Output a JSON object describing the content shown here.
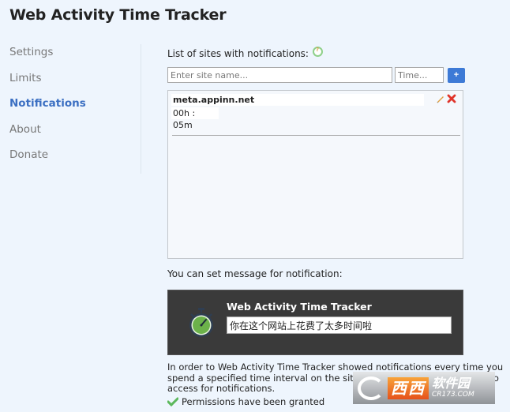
{
  "app": {
    "title": "Web Activity Time Tracker"
  },
  "sidebar": {
    "items": [
      {
        "label": "Settings",
        "active": false
      },
      {
        "label": "Limits",
        "active": false
      },
      {
        "label": "Notifications",
        "active": true
      },
      {
        "label": "About",
        "active": false
      },
      {
        "label": "Donate",
        "active": false
      }
    ]
  },
  "notifications": {
    "list_label": "List of sites with notifications:",
    "site_input": {
      "value": "",
      "placeholder": "Enter site name..."
    },
    "time_input": {
      "value": "",
      "placeholder": "Time..."
    },
    "add_button_label": "+",
    "sites": [
      {
        "name": "meta.appinn.net",
        "time": "00h : 05m"
      }
    ],
    "message_label": "You can set message for notification:",
    "preview": {
      "title": "Web Activity Time Tracker",
      "message": "你在这个网站上花费了太多时间啦"
    },
    "info_text": "In order to Web Activity Time Tracker showed notifications every time you spend a specified time interval on the site, you need grant permission to access for notifications.",
    "permission_status": "Permissions have been granted"
  },
  "watermark": {
    "brand": "西西",
    "name": "软件园",
    "url": "CR173.COM"
  },
  "colors": {
    "accent": "#3d7ad6",
    "active_nav": "#3b6fc2",
    "delete": "#e0342a",
    "success": "#5cb85c"
  }
}
